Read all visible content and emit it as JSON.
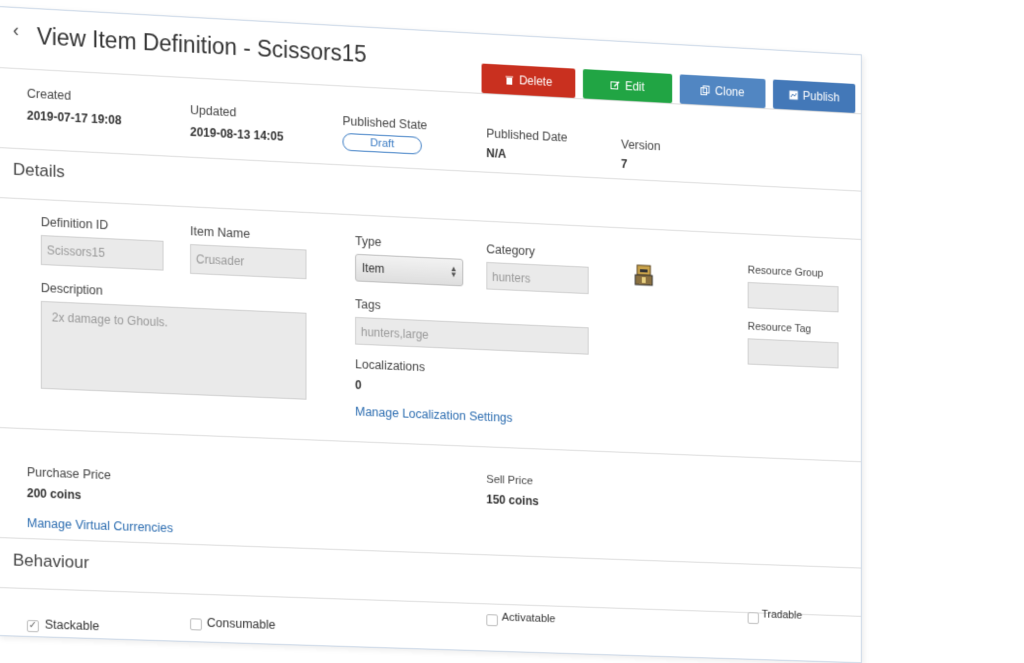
{
  "header": {
    "title": "View Item Definition - Scissors15",
    "buttons": {
      "delete": "Delete",
      "edit": "Edit",
      "clone": "Clone",
      "publish": "Publish"
    }
  },
  "meta": {
    "created_label": "Created",
    "created_value": "2019-07-17 19:08",
    "updated_label": "Updated",
    "updated_value": "2019-08-13 14:05",
    "published_state_label": "Published State",
    "published_state_value": "Draft",
    "published_date_label": "Published Date",
    "published_date_value": "N/A",
    "version_label": "Version",
    "version_value": "7"
  },
  "details": {
    "heading": "Details",
    "definition_id_label": "Definition ID",
    "definition_id_value": "Scissors15",
    "item_name_label": "Item Name",
    "item_name_value": "Crusader",
    "type_label": "Type",
    "type_value": "Item",
    "category_label": "Category",
    "category_value": "hunters",
    "description_label": "Description",
    "description_value": "2x damage to Ghouls.",
    "tags_label": "Tags",
    "tags_value": "hunters,large",
    "localizations_label": "Localizations",
    "localizations_value": "0",
    "manage_localization_link": "Manage Localization Settings",
    "resource_group_label": "Resource Group",
    "resource_group_value": "",
    "resource_tag_label": "Resource Tag",
    "resource_tag_value": ""
  },
  "pricing": {
    "purchase_label": "Purchase Price",
    "purchase_value": "200 coins",
    "sell_label": "Sell Price",
    "sell_value": "150 coins",
    "manage_currencies_link": "Manage Virtual Currencies"
  },
  "behaviour": {
    "heading": "Behaviour",
    "options": [
      {
        "label": "Stackable",
        "checked": true
      },
      {
        "label": "Consumable",
        "checked": false
      },
      {
        "label": "Activatable",
        "checked": false
      },
      {
        "label": "Tradable",
        "checked": false
      }
    ]
  },
  "icons": [
    "chevron-left-icon",
    "trash-icon",
    "edit-icon",
    "clone-icon",
    "publish-icon",
    "item-thumbnail-icon",
    "check-icon"
  ],
  "colors": {
    "delete": "#c9301f",
    "edit": "#21a544",
    "clone": "#5186c2",
    "publish": "#4378b8",
    "link": "#2b6cb0"
  }
}
